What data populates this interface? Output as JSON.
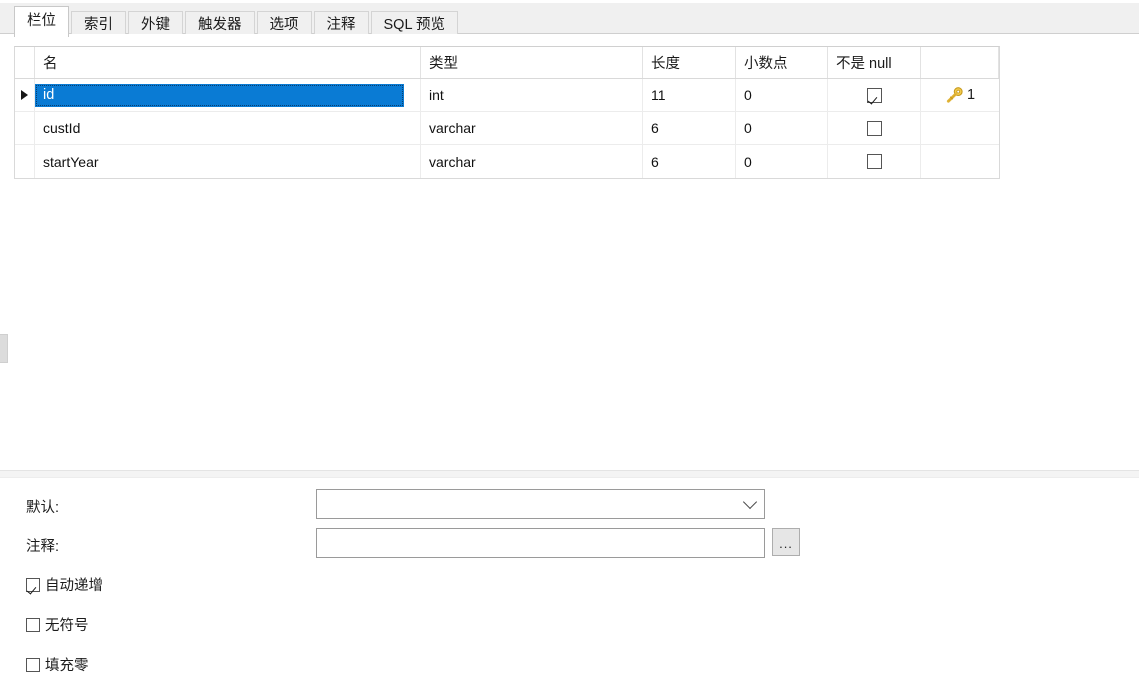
{
  "tabs": [
    {
      "label": "栏位",
      "active": true
    },
    {
      "label": "索引",
      "active": false
    },
    {
      "label": "外键",
      "active": false
    },
    {
      "label": "触发器",
      "active": false
    },
    {
      "label": "选项",
      "active": false
    },
    {
      "label": "注释",
      "active": false
    },
    {
      "label": "SQL 预览",
      "active": false
    }
  ],
  "grid": {
    "columns": {
      "name": "名",
      "type": "类型",
      "length": "长度",
      "decimals": "小数点",
      "not_null": "不是 null",
      "key": ""
    },
    "rows": [
      {
        "name": "id",
        "type": "int",
        "length": "11",
        "decimals": "0",
        "not_null": true,
        "key_index": "1",
        "key_icon": "key-icon",
        "selected": true,
        "current": true
      },
      {
        "name": "custId",
        "type": "varchar",
        "length": "6",
        "decimals": "0",
        "not_null": false,
        "key_index": "",
        "selected": false,
        "current": false
      },
      {
        "name": "startYear",
        "type": "varchar",
        "length": "6",
        "decimals": "0",
        "not_null": false,
        "key_index": "",
        "selected": false,
        "current": false
      }
    ]
  },
  "properties": {
    "default_label": "默认:",
    "default_value": "",
    "default_placeholder": "",
    "comment_label": "注释:",
    "comment_value": "",
    "comment_placeholder": "",
    "ellipsis_button": "...",
    "checkboxes": [
      {
        "label": "自动递增",
        "checked": true
      },
      {
        "label": "无符号",
        "checked": false
      },
      {
        "label": "填充零",
        "checked": false
      }
    ]
  },
  "colors": {
    "selection": "#0a7bd4",
    "key_gold": "#e8b93b",
    "tabstrip": "#f0f0f0"
  }
}
